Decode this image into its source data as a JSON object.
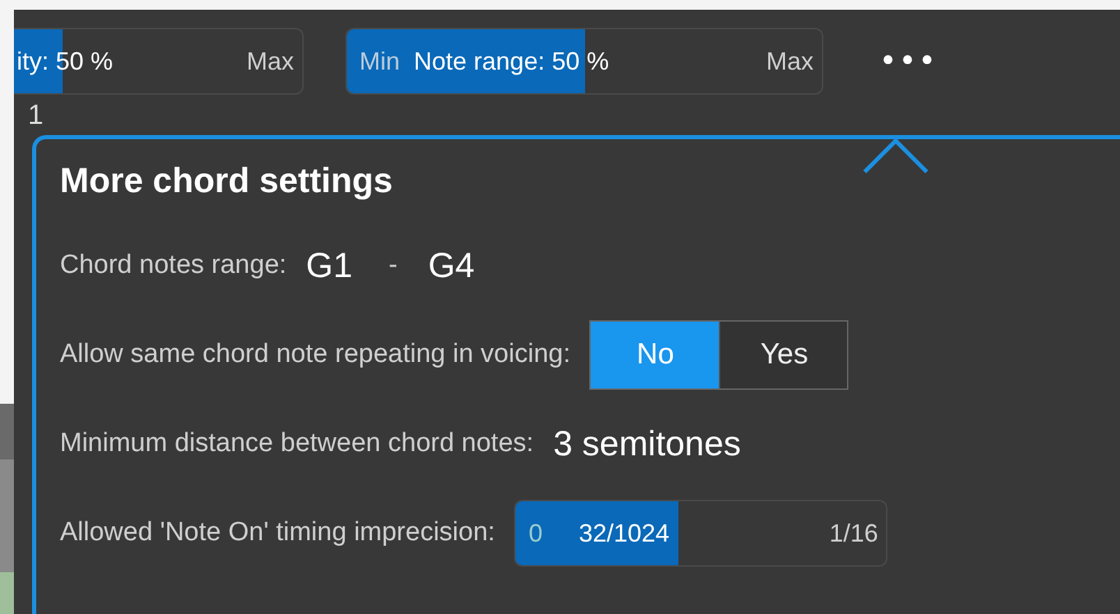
{
  "toolbar": {
    "sliders": [
      {
        "label": "ity: 50 %",
        "max": "Max",
        "level": 0.17
      },
      {
        "min": "Min",
        "label": "Note range: 50 %",
        "max": "Max",
        "level": 0.5
      }
    ],
    "more_button": "•••"
  },
  "track_number": "1",
  "popup": {
    "title": "More chord settings",
    "rows": [
      {
        "kind": "range",
        "label": "Chord notes range:",
        "from": "G1",
        "separator": "-",
        "to": "G4"
      },
      {
        "kind": "toggle",
        "label": "Allow same chord note repeating in voicing:",
        "options": [
          {
            "label": "No",
            "selected": true
          },
          {
            "label": "Yes",
            "selected": false
          }
        ]
      },
      {
        "kind": "value",
        "label": "Minimum distance between chord notes:",
        "value": "3 semitones"
      },
      {
        "kind": "slider",
        "label": "Allowed 'Note On' timing imprecision:",
        "min": "0",
        "value": "32/1024",
        "max": "1/16",
        "level": 0.44
      }
    ]
  }
}
